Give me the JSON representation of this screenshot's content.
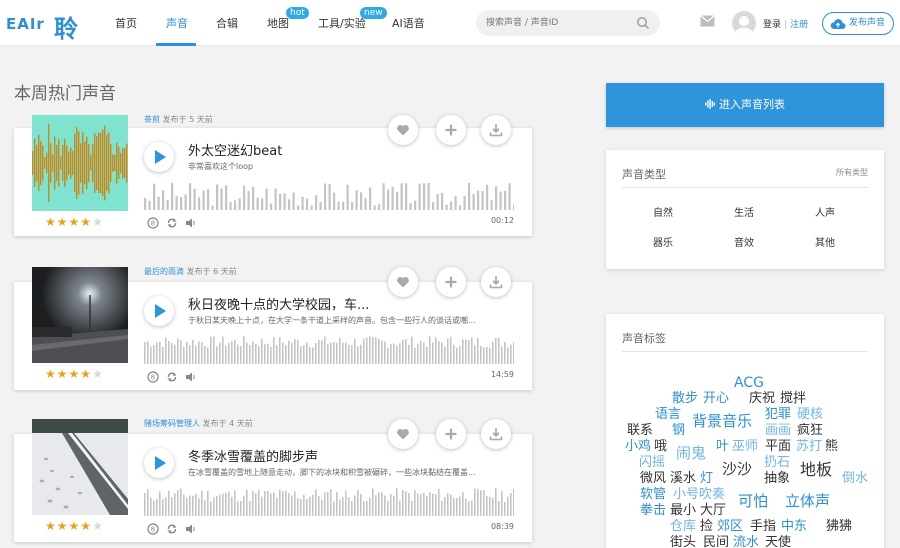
{
  "header": {
    "logo_text": "EAIr",
    "logo_cn": "聆",
    "nav": [
      {
        "label": "首页"
      },
      {
        "label": "声音",
        "active": true
      },
      {
        "label": "合辑"
      },
      {
        "label": "地图",
        "badge": "hot"
      },
      {
        "label": "工具/实验",
        "badge": "new"
      },
      {
        "label": "AI语音"
      }
    ],
    "search_placeholder": "搜索声音 / 声音ID",
    "login": "登录",
    "register": "注册",
    "publish": "发布声音"
  },
  "section_title": "本周热门声音",
  "sounds": [
    {
      "author": "茶煎",
      "posted": "发布于 5 天前",
      "title": "外太空迷幻beat",
      "desc": "非常喜欢这个loop",
      "rating": 4,
      "duration": "00:12"
    },
    {
      "author": "最后的雨滴",
      "posted": "发布于 6 天前",
      "title": "秋日夜晚十点的大学校园，车...",
      "desc": "于秋日某天晚上十点，在大学一条干道上采样的声音。包含一些行人的谈话或嘲...",
      "rating": 4,
      "duration": "14:59"
    },
    {
      "author": "赌场筹码管理人",
      "posted": "发布于 4 天前",
      "title": "冬季冰雪覆盖的脚步声",
      "desc": "在冰雪覆盖的雪地上随意走动，脚下的冰块和积雪被碾碎，一些冰块黏结在覆盖...",
      "rating": 4,
      "duration": "08:39"
    }
  ],
  "sidebar": {
    "enter_list": "进入声音列表",
    "types_title": "声音类型",
    "types_more": "所有类型",
    "types": [
      "自然",
      "生活",
      "人声",
      "器乐",
      "音效",
      "其他"
    ],
    "tags_title": "声音标签",
    "tags": [
      "ACG",
      "散步",
      "开心",
      "庆祝",
      "搅拌",
      "语言",
      "背景音乐",
      "犯罪",
      "硬核",
      "联系",
      "钢",
      "画画",
      "疯狂",
      "小鸡",
      "哦",
      "闹鬼",
      "叶",
      "巫师",
      "平面",
      "苏打",
      "熊",
      "闪摇",
      "扔石",
      "沙沙",
      "地板",
      "微风",
      "溪水",
      "灯",
      "抽象",
      "倒水",
      "软管",
      "小号吹奏",
      "可怕",
      "立体声",
      "拳击",
      "最小",
      "大厅",
      "仓库",
      "捡",
      "郊区",
      "手指",
      "中东",
      "狒狒",
      "街头",
      "民间",
      "流水",
      "天使"
    ]
  },
  "colors": {
    "accent": "#2e8fd9",
    "star": "#e9a21c",
    "tag_dark": "#333333",
    "tag_blue": "#2e8fd9",
    "tag_light": "#6fb6e6"
  }
}
